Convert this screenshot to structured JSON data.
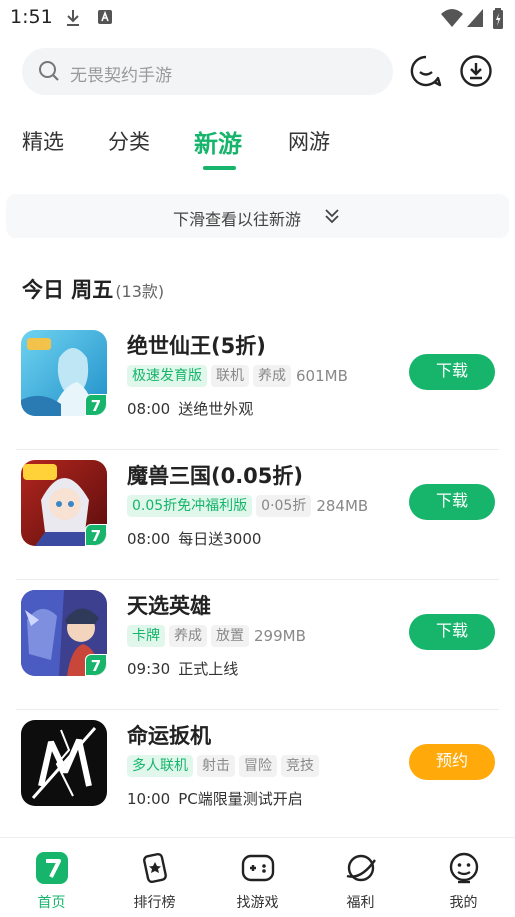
{
  "status_bar": {
    "time": "1:51",
    "icons": [
      "download-icon",
      "a-icon",
      "wifi-icon",
      "signal-icon",
      "battery-icon"
    ]
  },
  "search": {
    "placeholder": "无畏契约手游",
    "right_icons": [
      "message-icon",
      "download-manager-icon"
    ]
  },
  "tabs": [
    {
      "label": "精选",
      "active": false
    },
    {
      "label": "分类",
      "active": false
    },
    {
      "label": "新游",
      "active": true
    },
    {
      "label": "网游",
      "active": false
    }
  ],
  "history_bar": {
    "label": "下滑查看以往新游"
  },
  "day": {
    "title": "今日 周五",
    "count": "(13款)"
  },
  "games": [
    {
      "name": "绝世仙王(5折)",
      "tags": [
        {
          "text": "极速发育版",
          "highlight": true
        },
        {
          "text": "联机",
          "highlight": false
        },
        {
          "text": "养成",
          "highlight": false
        }
      ],
      "size": "601MB",
      "time": "08:00",
      "desc": "送绝世外观",
      "button": "下载",
      "button_type": "download",
      "icon": "game-icon-jueshi"
    },
    {
      "name": "魔兽三国(0.05折)",
      "tags": [
        {
          "text": "0.05折免冲福利版",
          "highlight": true
        },
        {
          "text": "0·05折",
          "highlight": false
        }
      ],
      "size": "284MB",
      "time": "08:00",
      "desc": "每日送3000",
      "button": "下载",
      "button_type": "download",
      "icon": "game-icon-moshou"
    },
    {
      "name": "天选英雄",
      "tags": [
        {
          "text": "卡牌",
          "highlight": true
        },
        {
          "text": "养成",
          "highlight": false
        },
        {
          "text": "放置",
          "highlight": false
        }
      ],
      "size": "299MB",
      "time": "09:30",
      "desc": "正式上线",
      "button": "下载",
      "button_type": "download",
      "icon": "game-icon-tianxuan"
    },
    {
      "name": "命运扳机",
      "tags": [
        {
          "text": "多人联机",
          "highlight": true
        },
        {
          "text": "射击",
          "highlight": false
        },
        {
          "text": "冒险",
          "highlight": false
        },
        {
          "text": "竞技",
          "highlight": false
        }
      ],
      "size": "",
      "time": "10:00",
      "desc": "PC端限量测试开启",
      "button": "预约",
      "button_type": "reserve",
      "icon": "game-icon-mingyun"
    }
  ],
  "badge_glyph": "7",
  "bottom_nav": [
    {
      "label": "首页",
      "icon": "home-icon",
      "active": true
    },
    {
      "label": "排行榜",
      "icon": "ranking-icon",
      "active": false
    },
    {
      "label": "找游戏",
      "icon": "gamepad-icon",
      "active": false
    },
    {
      "label": "福利",
      "icon": "planet-icon",
      "active": false
    },
    {
      "label": "我的",
      "icon": "profile-icon",
      "active": false
    }
  ],
  "colors": {
    "accent": "#16b56b",
    "reserve": "#ffa90a",
    "tag_highlight_bg": "#e2f7ec"
  }
}
